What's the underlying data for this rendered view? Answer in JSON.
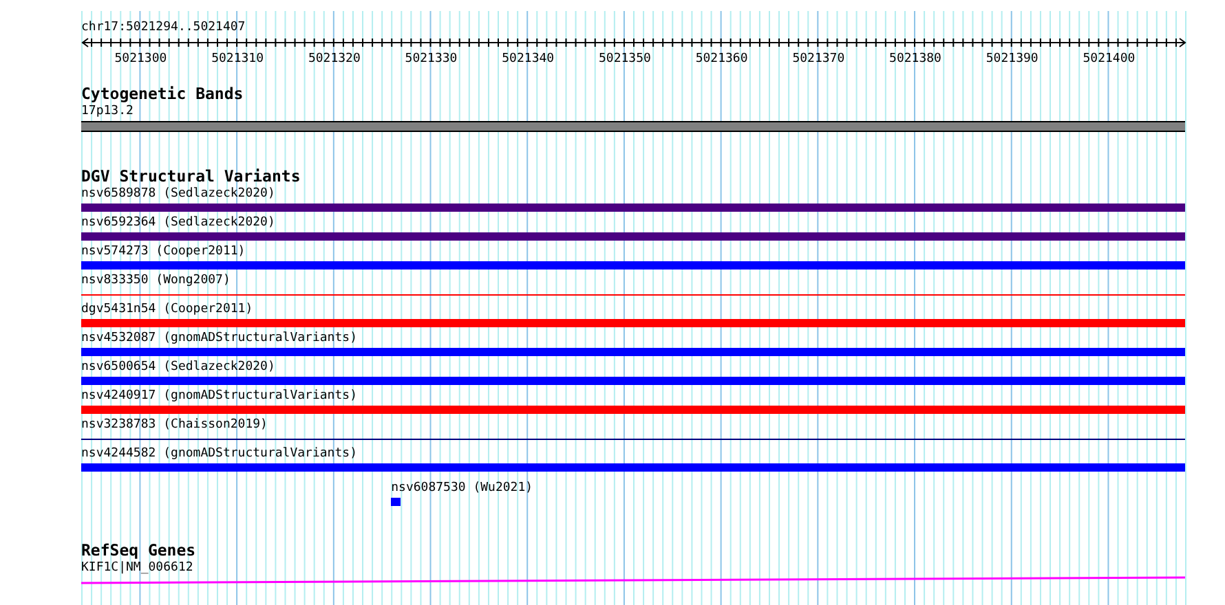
{
  "ruler": {
    "location": "chr17:5021294..5021407",
    "ticks": [
      "5021300",
      "5021310",
      "5021320",
      "5021330",
      "5021340",
      "5021350",
      "5021360",
      "5021370",
      "5021380",
      "5021390",
      "5021400"
    ]
  },
  "tracks": [
    {
      "kind": "cytoband",
      "title": "Cytogenetic Bands",
      "features": [
        {
          "label": "17p13.2"
        }
      ]
    },
    {
      "kind": "variants",
      "title": "DGV Structural Variants",
      "features": [
        {
          "label": "nsv6589878 (Sedlazeck2020)",
          "kind": "thick",
          "color": "#4b0082"
        },
        {
          "label": "nsv6592364 (Sedlazeck2020)",
          "kind": "thick",
          "color": "#4b0082"
        },
        {
          "label": "nsv574273 (Cooper2011)",
          "kind": "thick",
          "color": "#0000ff"
        },
        {
          "label": "nsv833350 (Wong2007)",
          "kind": "thin",
          "color": "#ff0000"
        },
        {
          "label": "dgv5431n54 (Cooper2011)",
          "kind": "thick",
          "color": "#ff0000"
        },
        {
          "label": "nsv4532087 (gnomADStructuralVariants)",
          "kind": "thick",
          "color": "#0000ff"
        },
        {
          "label": "nsv6500654 (Sedlazeck2020)",
          "kind": "thick",
          "color": "#0000ff"
        },
        {
          "label": "nsv4240917 (gnomADStructuralVariants)",
          "kind": "thick",
          "color": "#ff0000"
        },
        {
          "label": "nsv3238783 (Chaisson2019)",
          "kind": "thin",
          "color": "#000080"
        },
        {
          "label": "nsv4244582 (gnomADStructuralVariants)",
          "kind": "thick",
          "color": "#0000ff"
        },
        {
          "label": "nsv6087530 (Wu2021)",
          "kind": "block",
          "color": "#0000ff"
        }
      ]
    },
    {
      "kind": "genes",
      "title": "RefSeq Genes",
      "features": [
        {
          "label": "KIF1C|NM_006612"
        }
      ]
    }
  ]
}
